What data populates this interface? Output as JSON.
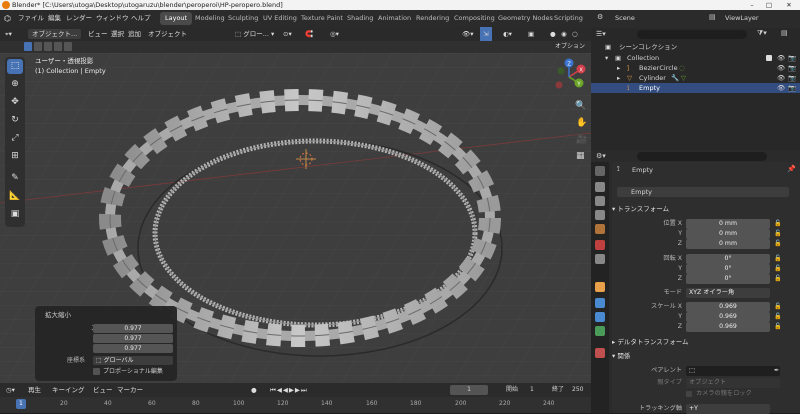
{
  "titlebar": {
    "text": "Blender* [C:\\Users\\utoga\\Desktop\\utogaruzu\\blender\\peroperoi\\HP-peropero.blend]"
  },
  "menubar": {
    "file": "ファイル",
    "edit": "編集",
    "render": "レンダー",
    "window": "ウィンドウ",
    "help": "ヘルプ"
  },
  "workspaces": [
    "Layout",
    "Modeling",
    "Sculpting",
    "UV Editing",
    "Texture Paint",
    "Shading",
    "Animation",
    "Rendering",
    "Compositing",
    "Geometry Nodes",
    "Scripting"
  ],
  "header3d": {
    "mode": "オブジェクト...",
    "view": "ビュー",
    "select": "選択",
    "add": "追加",
    "object": "オブジェクト",
    "transform_orient": "グロー...",
    "options": "オプション"
  },
  "viewport_overlay": {
    "line1": "ユーザー・透視投影",
    "line2": "(1) Collection | Empty"
  },
  "gizmo": {
    "x": "X",
    "y": "Y",
    "z": "Z"
  },
  "redo_panel": {
    "title": "拡大縮小",
    "scale_x_label": "スケール X",
    "y_label": "Y",
    "z_label": "Z",
    "scale_x": "0.977",
    "scale_y": "0.977",
    "scale_z": "0.977",
    "orient_label": "座標系",
    "orient_value": "グローバル",
    "proportional": "プロポーショナル編集"
  },
  "timeline": {
    "playback": "再生",
    "keying": "キーイング",
    "view": "ビュー",
    "marker": "マーカー",
    "current_frame": "1",
    "start_label": "開始",
    "start": "1",
    "end_label": "終了",
    "end": "250",
    "ticks": [
      "1",
      "20",
      "40",
      "60",
      "80",
      "100",
      "120",
      "140",
      "160",
      "180",
      "200",
      "220",
      "240"
    ]
  },
  "outliner_header": {
    "scene": "Scene",
    "view_layer": "ViewLayer"
  },
  "outliner": {
    "root": "シーンコレクション",
    "collection": "Collection",
    "items": [
      "BezierCircle",
      "Cylinder",
      "Empty"
    ]
  },
  "properties": {
    "object_name": "Empty",
    "name_field": "Empty",
    "transform": "トランスフォーム",
    "loc_x_label": "位置 X",
    "y_label": "Y",
    "z_label": "Z",
    "rot_x_label": "回転 X",
    "mode_label": "モード",
    "scale_x_label": "スケール X",
    "loc": [
      "0 mm",
      "0 mm",
      "0 mm"
    ],
    "rot": [
      "0°",
      "0°",
      "0°"
    ],
    "mode": "XYZ オイラー角",
    "scale": [
      "0.969",
      "0.969",
      "0.969"
    ],
    "delta": "デルタトランスフォーム",
    "relations": "関係",
    "parent_label": "ペアレント",
    "parent_type_label": "親タイプ",
    "parent_type": "オブジェクト",
    "camera_lock": "カメラの親をロック",
    "tracking_label": "トラッキング軸",
    "tracking": "+Y"
  },
  "colors": {
    "accent": "#4772b3",
    "selected_row": "#334d80",
    "x_axis": "#d23f4a",
    "y_axis": "#6ba52a",
    "z_axis": "#3a74d0"
  }
}
